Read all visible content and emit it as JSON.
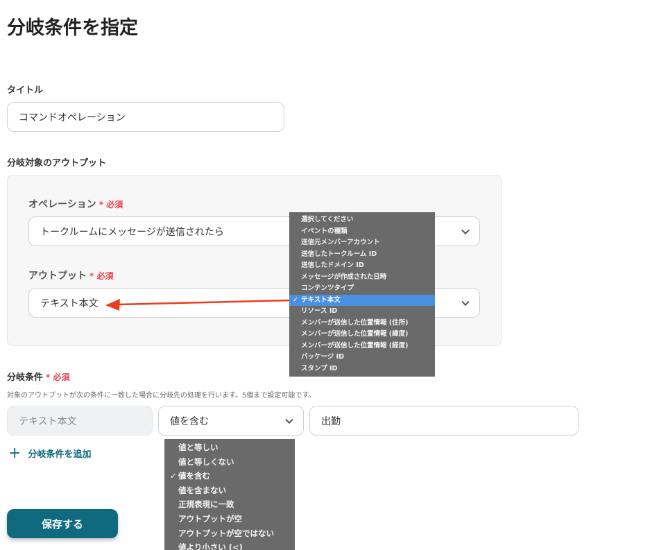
{
  "page_title": "分岐条件を指定",
  "title_field": {
    "label": "タイトル",
    "value": "コマンドオペレーション"
  },
  "output_section": {
    "label": "分岐対象のアウトプット",
    "operation": {
      "label": "オペレーション",
      "required": "必須",
      "value": "トークルームにメッセージが送信されたら"
    },
    "output": {
      "label": "アウトプット",
      "required": "必須",
      "value": "テキスト本文"
    }
  },
  "output_menu": {
    "items": [
      "選択してください",
      "イベントの種類",
      "送信元メンバーアカウント",
      "送信したトークルーム ID",
      "送信したドメイン ID",
      "メッセージが作成された日時",
      "コンテンツタイプ",
      "テキスト本文",
      "リソース ID",
      "メンバーが送信した位置情報 (住所)",
      "メンバーが送信した位置情報 (緯度)",
      "メンバーが送信した位置情報 (経度)",
      "パッケージ ID",
      "スタンプ ID"
    ],
    "selected_index": 7,
    "check": "✓"
  },
  "condition": {
    "label": "分岐条件",
    "required": "必須",
    "description": "対象のアウトプットが次の条件に一致した場合に分岐先の処理を行います。5個まで設定可能です。",
    "field": "テキスト本文",
    "operator": "値を含む",
    "value": "出勤",
    "add_label": "分岐条件を追加",
    "add_icon": "+"
  },
  "operator_menu": {
    "items": [
      "値と等しい",
      "値と等しくない",
      "値を含む",
      "値を含まない",
      "正規表現に一致",
      "アウトプットが空",
      "アウトプットが空ではない",
      "値より小さい (<)"
    ],
    "selected_index": 2,
    "check": "✓"
  },
  "save_label": "保存する",
  "colors": {
    "accent": "#0f6a80",
    "required": "#e8434f",
    "highlight": "#4a90e2",
    "arrow": "#f03a1c"
  }
}
